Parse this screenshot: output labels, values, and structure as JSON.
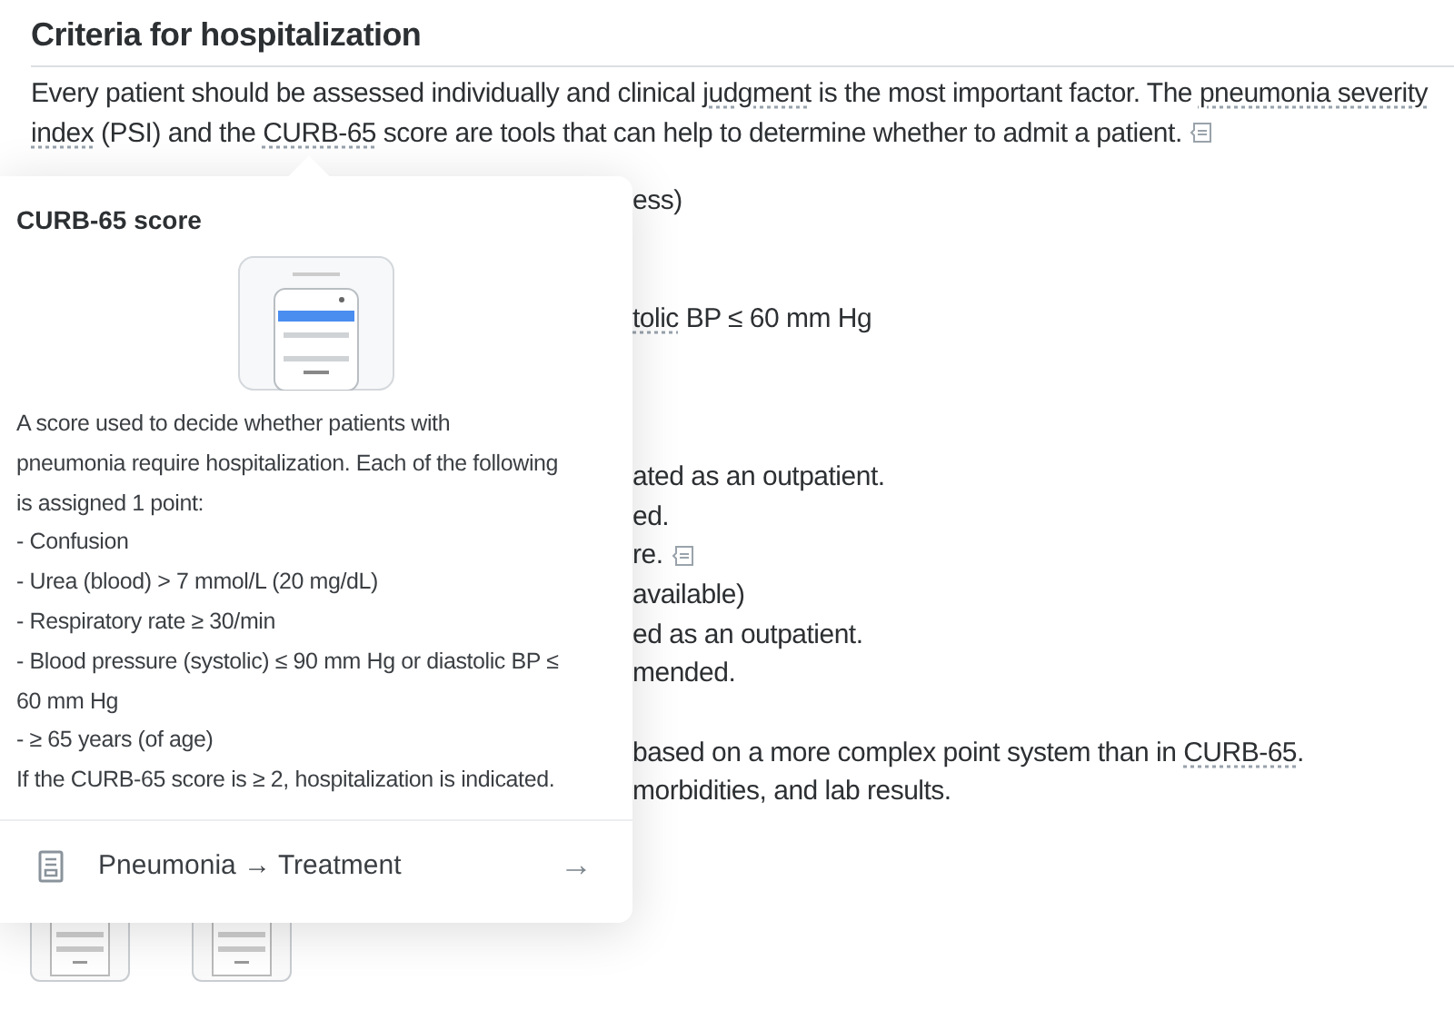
{
  "article": {
    "heading": "Criteria for hospitalization",
    "intro": [
      {
        "kind": "text",
        "text": "Every patient should be assessed individually and clinical "
      },
      {
        "kind": "link",
        "text": "judgment"
      },
      {
        "kind": "text",
        "text": " is the most important factor. The "
      },
      {
        "kind": "link",
        "text": "pneumonia severity"
      },
      {
        "kind": "link",
        "text": "index"
      },
      {
        "kind": "text",
        "text": " (PSI) and the "
      },
      {
        "kind": "link",
        "text": "CURB-65"
      },
      {
        "kind": "text",
        "text": " score are tools that can help to determine whether to admit a patient."
      }
    ],
    "lines": [
      {
        "kind": "text",
        "segments": [
          {
            "kind": "text",
            "text": "ess)"
          }
        ]
      },
      {
        "kind": "blank"
      },
      {
        "kind": "blank"
      },
      {
        "kind": "text",
        "segments": [
          {
            "kind": "link",
            "text": "tolic"
          },
          {
            "kind": "text",
            "text": " BP ≤ 60 mm Hg"
          }
        ]
      },
      {
        "kind": "blank"
      },
      {
        "kind": "blank"
      },
      {
        "kind": "blank"
      },
      {
        "kind": "text",
        "segments": [
          {
            "kind": "text",
            "text": "ated as an outpatient."
          }
        ]
      },
      {
        "kind": "text",
        "segments": [
          {
            "kind": "text",
            "text": "ed."
          }
        ]
      },
      {
        "kind": "text",
        "segments": [
          {
            "kind": "text",
            "text": "re."
          }
        ],
        "note": true
      },
      {
        "kind": "text",
        "segments": [
          {
            "kind": "text",
            "text": "available)"
          }
        ]
      },
      {
        "kind": "text",
        "segments": [
          {
            "kind": "text",
            "text": "ed as an outpatient."
          }
        ]
      },
      {
        "kind": "text",
        "segments": [
          {
            "kind": "text",
            "text": "mended."
          }
        ]
      },
      {
        "kind": "blank"
      },
      {
        "kind": "text",
        "segments": [
          {
            "kind": "text",
            "text": "based on a more complex point system than in "
          },
          {
            "kind": "link",
            "text": "CURB-65"
          },
          {
            "kind": "text",
            "text": "."
          }
        ]
      },
      {
        "kind": "text",
        "segments": [
          {
            "kind": "text",
            "text": "morbidities, and lab results."
          }
        ]
      }
    ]
  },
  "popover": {
    "title": "CURB-65 score",
    "lines": [
      "A score used to decide whether patients with",
      "pneumonia require hospitalization. Each of the following",
      "is assigned 1 point:",
      "- Confusion",
      "- Urea (blood) > 7 mmol/L (20 mg/dL)",
      "- Respiratory rate ≥ 30/min",
      "- Blood pressure (systolic) ≤ 90 mm Hg or diastolic BP ≤",
      "60 mm Hg",
      "- ≥ 65 years (of age)",
      "If the CURB-65 score is ≥ 2, hospitalization is indicated."
    ],
    "link": {
      "label": "Pneumonia → Treatment",
      "arrow": "→"
    }
  }
}
